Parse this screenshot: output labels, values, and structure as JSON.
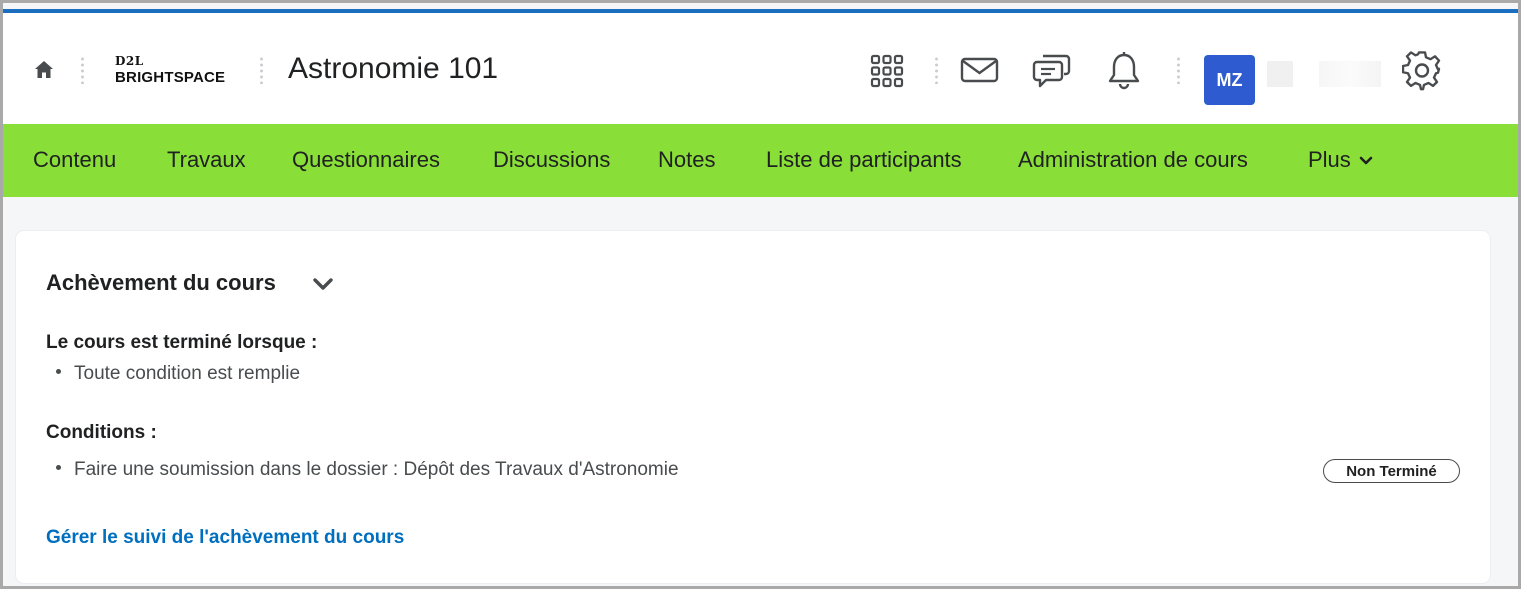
{
  "header": {
    "logo_line1": "D2L",
    "logo_line2": "BRIGHTSPACE",
    "course_title": "Astronomie 101",
    "avatar_initials": "MZ",
    "icons": [
      "home-icon",
      "waffle-grid-icon",
      "mail-icon",
      "chat-icon",
      "bell-icon",
      "gear-icon"
    ]
  },
  "nav": {
    "items": [
      {
        "label": "Contenu"
      },
      {
        "label": "Travaux"
      },
      {
        "label": "Questionnaires"
      },
      {
        "label": "Discussions"
      },
      {
        "label": "Notes"
      },
      {
        "label": "Liste de participants"
      },
      {
        "label": "Administration de cours"
      },
      {
        "label": "Plus"
      }
    ]
  },
  "completion": {
    "title": "Achèvement du cours",
    "completed_when_label": "Le cours est terminé lorsque :",
    "completed_when_item": "Toute condition est remplie",
    "conditions_label": "Conditions :",
    "condition_item": "Faire une soumission dans le dossier : Dépôt des Travaux d'Astronomie",
    "condition_status": "Non Terminé",
    "manage_link": "Gérer le suivi de l'achèvement du cours"
  },
  "colors": {
    "nav_bg": "#8ade38",
    "accent_line": "#1c6fc0",
    "avatar_bg": "#2f5bd1",
    "link": "#006fbf"
  }
}
